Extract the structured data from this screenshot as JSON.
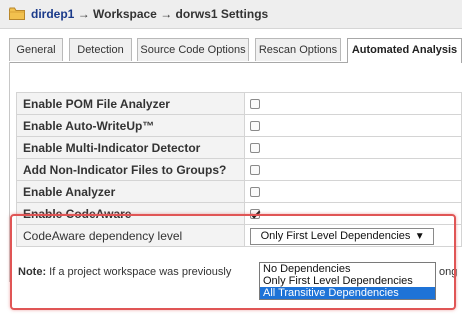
{
  "breadcrumb": {
    "project": "dirdep1",
    "separator": "→",
    "workspace": "Workspace",
    "page": "dorws1 Settings"
  },
  "tabs": [
    {
      "label": "General",
      "active": false
    },
    {
      "label": "Detection",
      "active": false
    },
    {
      "label": "Source Code Options",
      "active": false
    },
    {
      "label": "Rescan Options",
      "active": false
    },
    {
      "label": "Automated Analysis",
      "active": true
    }
  ],
  "settings": [
    {
      "label": "Enable POM File Analyzer",
      "checked": false
    },
    {
      "label": "Enable Auto-WriteUp™",
      "checked": false
    },
    {
      "label": "Enable Multi-Indicator Detector",
      "checked": false
    },
    {
      "label": "Add Non-Indicator Files to Groups?",
      "checked": false
    },
    {
      "label": "Enable Analyzer",
      "checked": false
    },
    {
      "label": "Enable CodeAware",
      "checked": true
    }
  ],
  "dependency": {
    "label": "CodeAware dependency level",
    "selected": "Only First Level Dependencies",
    "arrow": "▼",
    "options": [
      "No Dependencies",
      "Only First Level Dependencies",
      "All Transitive Dependencies"
    ],
    "highlighted_option": "All Transitive Dependencies"
  },
  "note": {
    "label": "Note:",
    "text": "If a project workspace was previously",
    "tail": "ongly"
  },
  "colors": {
    "highlight_box": "#e05555",
    "selected_option": "#1e73d7",
    "folder": "#f2c14e"
  }
}
